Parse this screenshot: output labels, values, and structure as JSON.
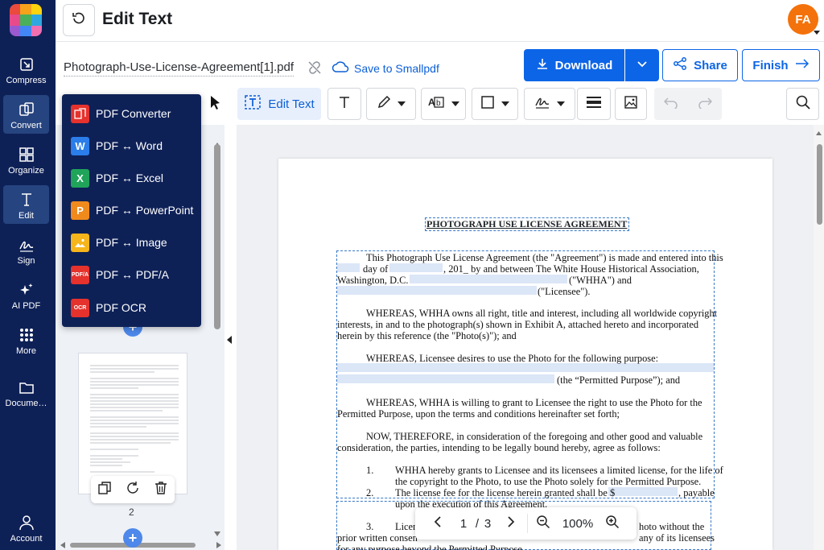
{
  "app": {
    "title": "Edit Text"
  },
  "user": {
    "initials": "FA"
  },
  "nav": {
    "items": [
      {
        "label": "Compress"
      },
      {
        "label": "Convert"
      },
      {
        "label": "Organize"
      },
      {
        "label": "Edit"
      },
      {
        "label": "Sign"
      },
      {
        "label": "AI PDF"
      },
      {
        "label": "More"
      },
      {
        "label": "Docume…"
      },
      {
        "label": "Account"
      }
    ]
  },
  "file": {
    "name": "Photograph-Use-License-Agreement[1].pdf",
    "save_label": "Save to Smallpdf"
  },
  "actions": {
    "download": "Download",
    "share": "Share",
    "finish": "Finish"
  },
  "toolbar": {
    "edit_text": "Edit Text"
  },
  "convert_menu": {
    "items": [
      {
        "label": "PDF Converter",
        "icon": "converter-icon",
        "color": "#e5322d"
      },
      {
        "label": "PDF ↔ Word",
        "icon": "word-icon",
        "color": "#2b7de9"
      },
      {
        "label": "PDF ↔ Excel",
        "icon": "excel-icon",
        "color": "#1fa45a"
      },
      {
        "label": "PDF ↔ PowerPoint",
        "icon": "powerpoint-icon",
        "color": "#f08a1c"
      },
      {
        "label": "PDF ↔ Image",
        "icon": "image-icon",
        "color": "#f5b51b"
      },
      {
        "label": "PDF ↔ PDF/A",
        "icon": "pdfa-icon",
        "color": "#e5322d"
      },
      {
        "label": "PDF OCR",
        "icon": "ocr-icon",
        "color": "#e5322d"
      }
    ],
    "pdfa_badge": "PDF/A",
    "ocr_badge": "OCR"
  },
  "thumbnails": {
    "page_number": "2"
  },
  "document": {
    "title": "PHOTOGRAPH USE LICENSE AGREEMENT",
    "lines": [
      "This Photograph Use License Agreement (the \"Agreement\") is made and entered into this",
      "day of",
      ", 201_ by and between The White House Historical Association,",
      "Washington, D.C.",
      "(\"WHHA\") and",
      "(\"Licensee\").",
      "WHEREAS, WHHA owns all right, title and interest, including all worldwide copyright",
      "interests, in and to the photograph(s) shown in Exhibit A, attached hereto and incorporated",
      "herein by this reference (the \"Photo(s)\"); and",
      "WHEREAS, Licensee desires to use the Photo for the following purpose:",
      "(the “Permitted Purpose”); and",
      "WHEREAS, WHHA is willing to grant to Licensee the right to use the Photo for the",
      "Permitted Purpose, upon the terms and conditions hereinafter set forth;",
      "NOW, THEREFORE, in consideration of the foregoing and other good and valuable",
      "consideration, the parties, intending to be legally bound hereby, agree as follows:",
      "1.",
      "WHHA hereby grants to Licensee and its licensees a limited license, for the life of",
      "the copyright to the Photo, to use the Photo solely for the Permitted Purpose.",
      "2.",
      "The license fee for the license herein granted shall be $",
      ", payable",
      "upon the execution of this Agreement.",
      "3.",
      "Licer",
      "hoto without the",
      "prior written consen",
      "any of its licensees",
      "for any purpose beyond the Permitted Purpose."
    ]
  },
  "pager": {
    "current": "1",
    "separator": "/",
    "total": "3",
    "zoom": "100%"
  }
}
